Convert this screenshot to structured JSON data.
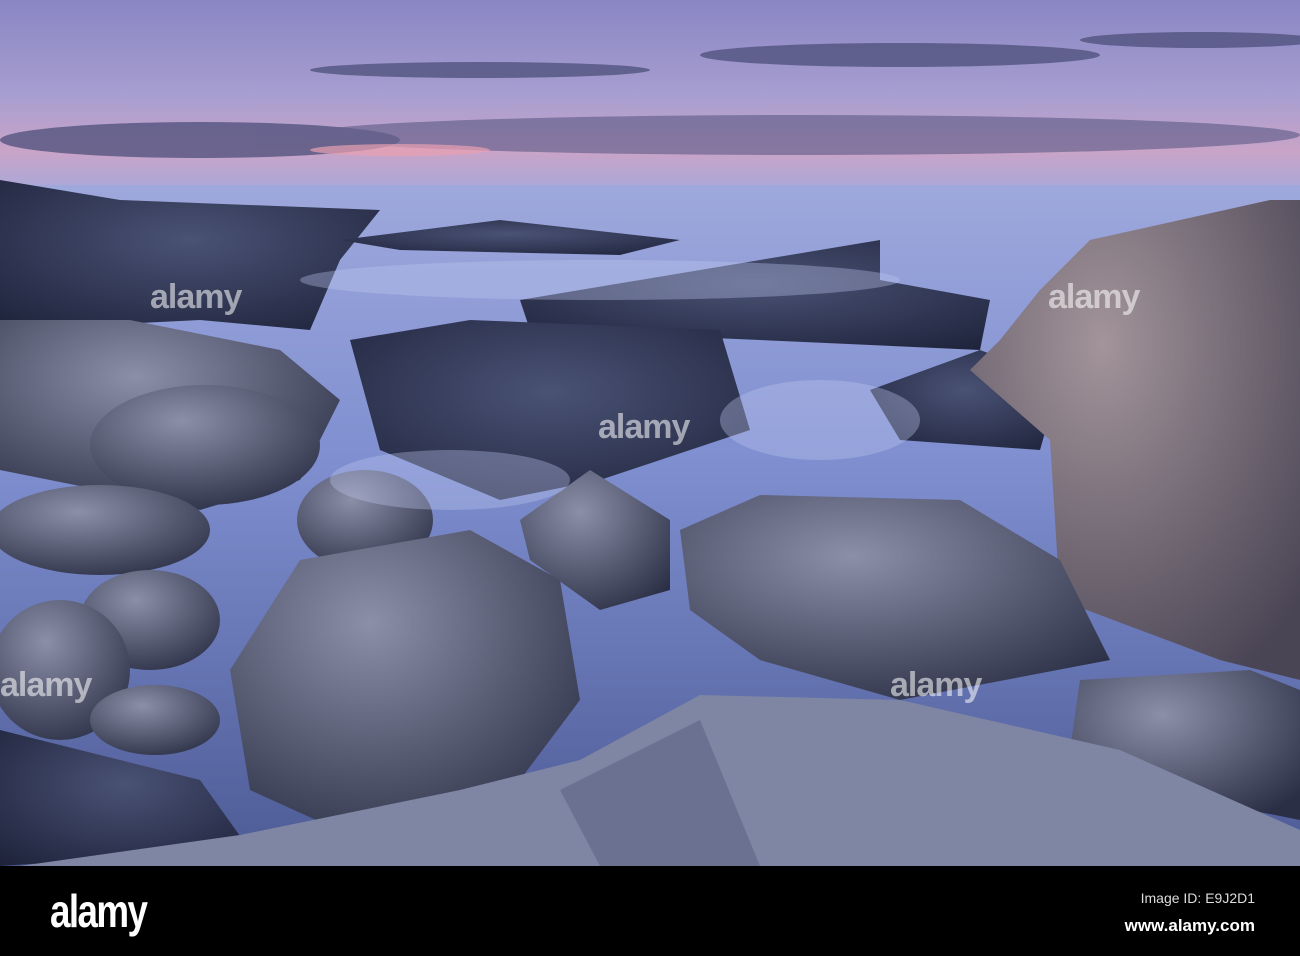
{
  "watermark": {
    "brand": "alamy"
  },
  "footer": {
    "logo": "alamy",
    "image_id": "Image ID: E9J2D1",
    "website": "www.alamy.com"
  }
}
